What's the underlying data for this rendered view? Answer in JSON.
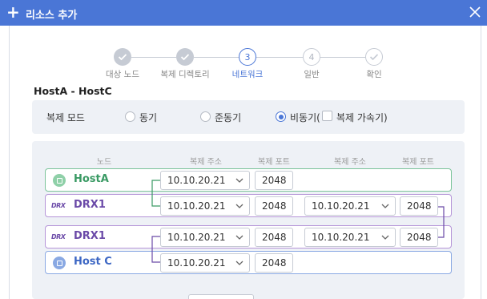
{
  "window": {
    "title": "리소스 추가",
    "add_icon": "plus-icon",
    "close_icon": "close-icon"
  },
  "stepper": {
    "steps": [
      {
        "label": "대상 노드",
        "state": "done"
      },
      {
        "label": "복제 디렉토리",
        "state": "done"
      },
      {
        "label": "네트워크",
        "state": "active",
        "number": "3"
      },
      {
        "label": "일반",
        "state": "todo",
        "number": "4"
      },
      {
        "label": "확인",
        "state": "todo"
      }
    ]
  },
  "section": {
    "title": "HostA - HostC"
  },
  "replication_mode": {
    "label": "복제 모드",
    "options": [
      {
        "label": "동기",
        "selected": false
      },
      {
        "label": "준동기",
        "selected": false
      },
      {
        "label": "비동기(",
        "selected": true
      }
    ],
    "accelerator": {
      "label": "복제 가속기)",
      "checked": false
    }
  },
  "table": {
    "headers": {
      "node": "노드",
      "addr1": "복제 주소",
      "port1": "복제 포트",
      "addr2": "복제 주소",
      "port2": "복제 포트"
    },
    "rows": [
      {
        "node": "HostA",
        "icon": "host-icon",
        "addr1": "10.10.20.21",
        "port1": "2048",
        "addr2": "",
        "port2": ""
      },
      {
        "node": "DRX1",
        "icon": "drx-icon",
        "icon_text": "DRX",
        "addr1": "10.10.20.21",
        "port1": "2048",
        "addr2": "10.10.20.21",
        "port2": "2048"
      },
      {
        "node": "DRX1",
        "icon": "drx-icon",
        "icon_text": "DRX",
        "addr1": "10.10.20.21",
        "port1": "2048",
        "addr2": "10.10.20.21",
        "port2": "2048"
      },
      {
        "node": "Host C",
        "icon": "host-icon",
        "addr1": "10.10.20.21",
        "port1": "2048",
        "addr2": "",
        "port2": ""
      }
    ]
  },
  "colors": {
    "accent": "#4a76d6",
    "host_green": "#3a9a64",
    "drx_purple": "#6b4aa8",
    "host_blue": "#3d67c4"
  }
}
